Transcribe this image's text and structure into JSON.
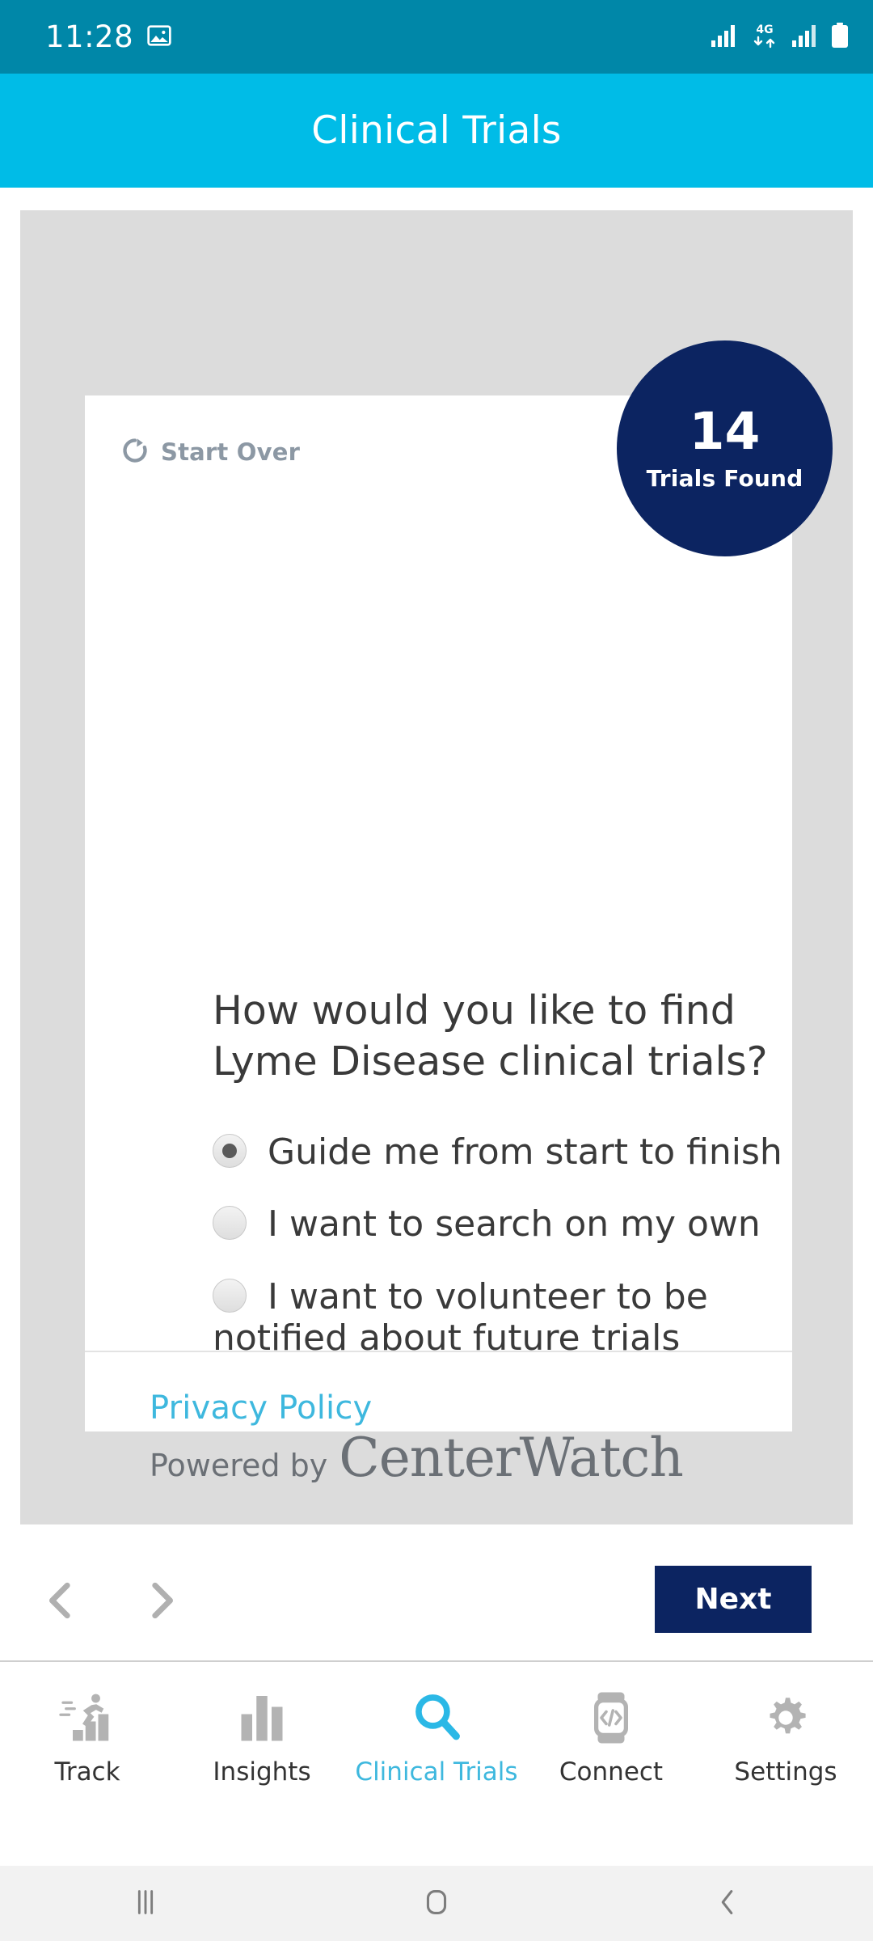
{
  "status_bar": {
    "time": "11:28",
    "icons": [
      "image-icon",
      "signal-bars-icon",
      "4g-data-icon",
      "signal-bars-2-icon",
      "battery-icon"
    ],
    "network_label": "4G",
    "background_color": "#0087A8"
  },
  "app_bar": {
    "title": "Clinical Trials",
    "background_color": "#00BCE7"
  },
  "card": {
    "start_over_label": "Start Over",
    "badge": {
      "count": "14",
      "label": "Trials Found",
      "background_color": "#0C2461"
    },
    "question": "How would you like to find Lyme Disease clinical trials?",
    "options": [
      {
        "label": "Guide me from start to finish",
        "selected": true
      },
      {
        "label": "I want to search on my own",
        "selected": false
      },
      {
        "label": "I want to volunteer to be notified about future trials",
        "selected": false
      }
    ],
    "next_label": "Next",
    "footer": {
      "privacy_label": "Privacy Policy",
      "privacy_color": "#3EB8DE",
      "powered_by_label": "Powered by",
      "brand_label": "CenterWatch"
    }
  },
  "pager": {
    "prev_icon": "chevron-left-icon",
    "next_icon": "chevron-right-icon"
  },
  "tab_bar": {
    "active_color": "#3EB8DE",
    "inactive_color": "#333333",
    "tabs": [
      {
        "label": "Track",
        "icon": "runner-bars-icon",
        "active": false
      },
      {
        "label": "Insights",
        "icon": "bar-chart-icon",
        "active": false
      },
      {
        "label": "Clinical Trials",
        "icon": "search-icon",
        "active": true
      },
      {
        "label": "Connect",
        "icon": "smartwatch-code-icon",
        "active": false
      },
      {
        "label": "Settings",
        "icon": "gear-icon",
        "active": false
      }
    ]
  },
  "nav_bar": {
    "recents_icon": "recents-icon",
    "home_icon": "home-icon",
    "back_icon": "back-icon"
  }
}
